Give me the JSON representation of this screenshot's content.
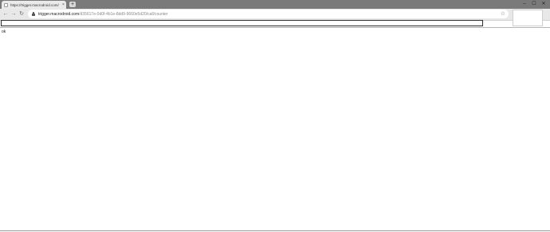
{
  "browser": {
    "tab": {
      "title": "https://trigger.macrodroid.com/",
      "close": "×"
    },
    "new_tab": "+",
    "window_controls": {
      "minimize": "–",
      "maximize": "☐",
      "close": "✕"
    },
    "nav": {
      "back": "←",
      "forward": "→",
      "reload": "↻"
    },
    "address": {
      "host": "trigger.macrodroid.com",
      "path": "/d35617e-0d0f-4b1e-8dd9-9660e5d20/call/counter"
    },
    "bookmark_star": "☆"
  },
  "page": {
    "text": "ok"
  }
}
